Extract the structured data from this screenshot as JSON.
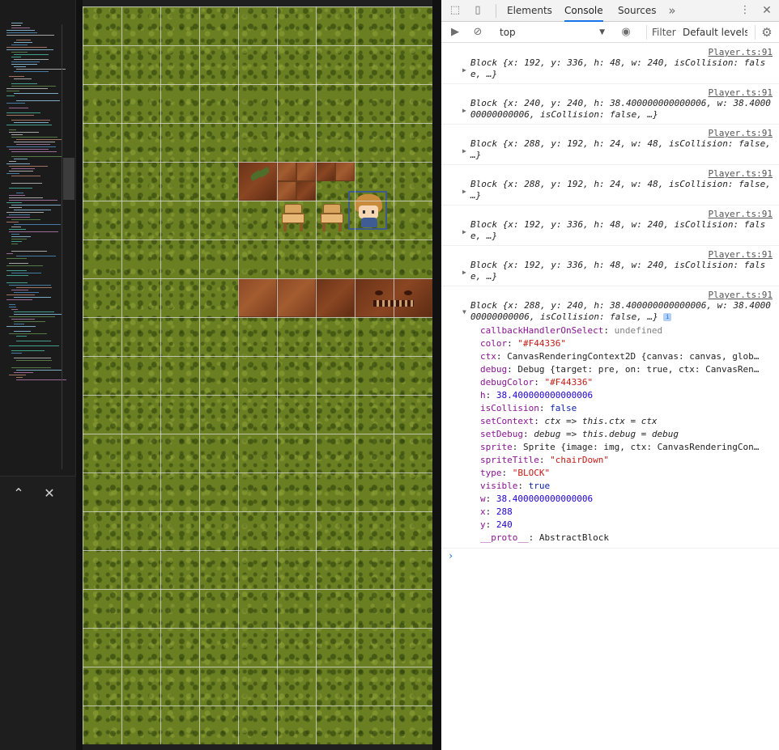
{
  "minimap": {
    "collapse_icon": "chevron-up-icon",
    "close_icon": "close-icon",
    "collapse_glyph": "⌃",
    "close_glyph": "✕"
  },
  "devtools": {
    "tabs": [
      "Elements",
      "Console",
      "Sources"
    ],
    "active_tab": "Console",
    "more_tabs_glyph": "»",
    "context": "top",
    "filter_placeholder": "Filter",
    "levels_label": "Default levels ▾",
    "accent": "#1a73e8"
  },
  "console": {
    "entries": [
      {
        "source": "Player.ts:91",
        "summary": "Block {x: 192, y: 336, h: 48, w: 240, isCollision: false, …}"
      },
      {
        "source": "Player.ts:91",
        "summary": "Block {x: 240, y: 240, h: 38.400000000000006, w: 38.400000000000006, isCollision: false, …}"
      },
      {
        "source": "Player.ts:91",
        "summary": "Block {x: 288, y: 192, h: 24, w: 48, isCollision: false, …}"
      },
      {
        "source": "Player.ts:91",
        "summary": "Block {x: 288, y: 192, h: 24, w: 48, isCollision: false, …}"
      },
      {
        "source": "Player.ts:91",
        "summary": "Block {x: 192, y: 336, h: 48, w: 240, isCollision: false, …}"
      },
      {
        "source": "Player.ts:91",
        "summary": "Block {x: 192, y: 336, h: 48, w: 240, isCollision: false, …}"
      }
    ],
    "expanded": {
      "source": "Player.ts:91",
      "summary": "Block {x: 288, y: 240, h: 38.400000000000006, w: 38.400000000000006, isCollision: false, …}",
      "properties": [
        {
          "name": "callbackHandlerOnSelect",
          "value": "undefined",
          "kind": "undef",
          "expandable": false
        },
        {
          "name": "color",
          "value": "\"#F44336\"",
          "kind": "str",
          "expandable": false
        },
        {
          "name": "ctx",
          "value": "CanvasRenderingContext2D {canvas: canvas, glob…",
          "kind": "obj",
          "expandable": true
        },
        {
          "name": "debug",
          "value": "Debug {target: pre, on: true, ctx: CanvasRen…",
          "kind": "obj",
          "expandable": true
        },
        {
          "name": "debugColor",
          "value": "\"#F44336\"",
          "kind": "str",
          "expandable": false
        },
        {
          "name": "h",
          "value": "38.400000000000006",
          "kind": "num",
          "expandable": false
        },
        {
          "name": "isCollision",
          "value": "false",
          "kind": "kw",
          "expandable": false
        },
        {
          "name": "setContext",
          "value": "ctx => this.ctx = ctx",
          "kind": "fn",
          "expandable": true
        },
        {
          "name": "setDebug",
          "value": "debug => this.debug = debug",
          "kind": "fn",
          "expandable": true
        },
        {
          "name": "sprite",
          "value": "Sprite {image: img, ctx: CanvasRenderingCon…",
          "kind": "obj",
          "expandable": true
        },
        {
          "name": "spriteTitle",
          "value": "\"chairDown\"",
          "kind": "str",
          "expandable": false
        },
        {
          "name": "type",
          "value": "\"BLOCK\"",
          "kind": "str",
          "expandable": false
        },
        {
          "name": "visible",
          "value": "true",
          "kind": "kw",
          "expandable": false
        },
        {
          "name": "w",
          "value": "38.400000000000006",
          "kind": "num",
          "expandable": false
        },
        {
          "name": "x",
          "value": "288",
          "kind": "num",
          "expandable": false
        },
        {
          "name": "y",
          "value": "240",
          "kind": "num",
          "expandable": false
        },
        {
          "name": "__proto__",
          "value": "AbstractBlock",
          "kind": "obj",
          "expandable": true
        }
      ]
    },
    "prompt_glyph": "›"
  },
  "game": {
    "grass_color": "#6a7e22",
    "wood_color": "#a35c30",
    "highlight_color": "#3d5a8c"
  }
}
